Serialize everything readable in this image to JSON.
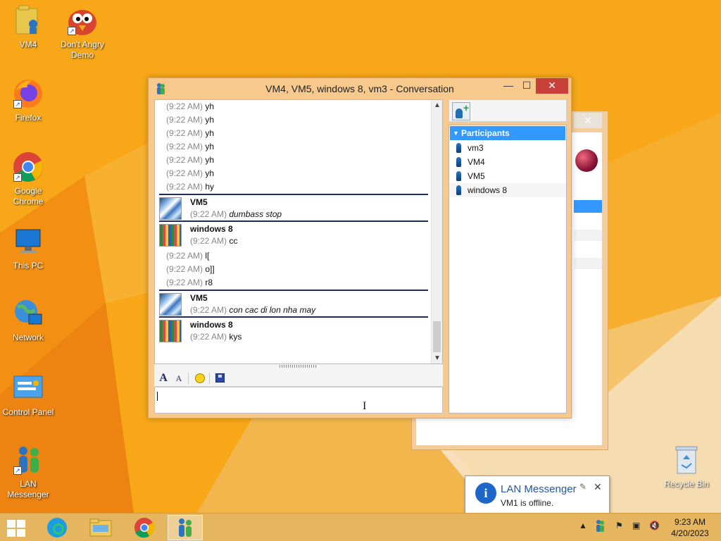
{
  "desktop": {
    "icons": [
      {
        "label": "VM4"
      },
      {
        "label": "Don't Angry\nDemo"
      },
      {
        "label": "Firefox"
      },
      {
        "label": "Google\nChrome"
      },
      {
        "label": "This PC"
      },
      {
        "label": "Network"
      },
      {
        "label": "Control Panel"
      },
      {
        "label": "LAN\nMessenger"
      },
      {
        "label": "Recycle Bin"
      }
    ]
  },
  "conversation": {
    "title": "VM4, VM5, windows 8, vm3 - Conversation",
    "controls": {
      "minimize": "—",
      "maximize": "☐",
      "close": "✕"
    },
    "top_lines": [
      {
        "ts": "(9:22 AM)",
        "text": "yh"
      },
      {
        "ts": "(9:22 AM)",
        "text": "yh"
      },
      {
        "ts": "(9:22 AM)",
        "text": "yh"
      },
      {
        "ts": "(9:22 AM)",
        "text": "yh"
      },
      {
        "ts": "(9:22 AM)",
        "text": "yh"
      },
      {
        "ts": "(9:22 AM)",
        "text": "yh"
      },
      {
        "ts": "(9:22 AM)",
        "text": "hy"
      }
    ],
    "blocks": [
      {
        "sender": "VM5",
        "ts": "(9:22 AM)",
        "text": "dumbass stop"
      },
      {
        "sender": "windows 8",
        "ts": "(9:22 AM)",
        "text": "cc"
      },
      {
        "sender": "VM5",
        "ts": "(9:22 AM)",
        "text": "con cac di lon nha may"
      },
      {
        "sender": "windows 8",
        "ts": "(9:22 AM)",
        "text": "kys"
      }
    ],
    "extra_lines": [
      {
        "ts": "(9:22 AM)",
        "text": "l["
      },
      {
        "ts": "(9:22 AM)",
        "text": "o]]"
      },
      {
        "ts": "(9:22 AM)",
        "text": "r8"
      }
    ],
    "format_bar": {
      "font_glyph": "A",
      "style_glyph": "A"
    },
    "input": {
      "value": ""
    },
    "participants": {
      "header": "Participants",
      "items": [
        "vm3",
        "VM4",
        "VM5",
        "windows 8"
      ]
    }
  },
  "notification": {
    "title": "LAN Messenger",
    "body": "VM1 is offline.",
    "info_glyph": "i",
    "pin_glyph": "✎",
    "close_glyph": "✕"
  },
  "taskbar": {
    "clock_time": "9:23 AM",
    "clock_date": "4/20/2023"
  }
}
